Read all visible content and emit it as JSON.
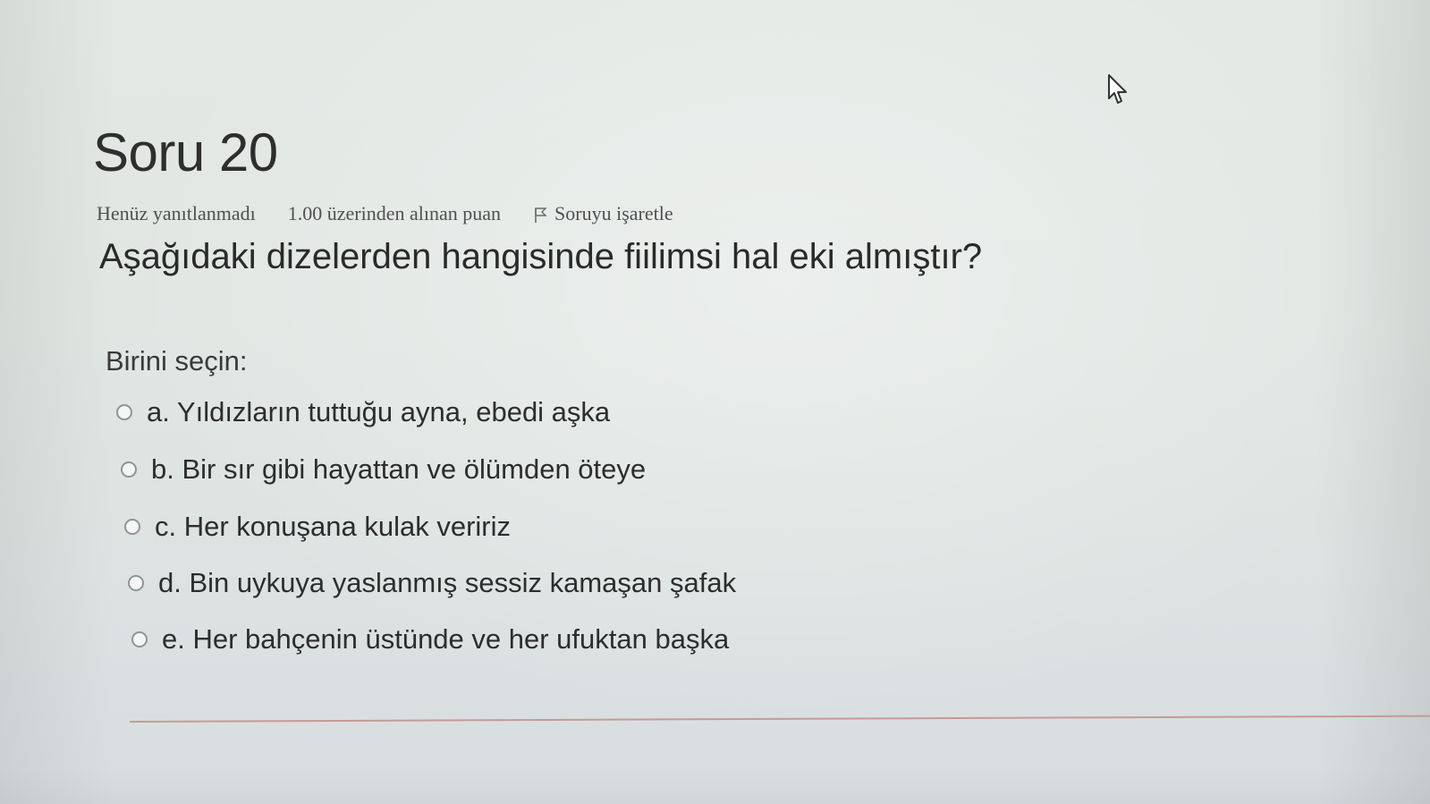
{
  "question": {
    "title": "Soru 20",
    "status": "Henüz yanıtlanmadı",
    "grade": "1.00 üzerinden alınan puan",
    "flag_label": "Soruyu işaretle",
    "text": "Aşağıdaki dizelerden hangisinde fiilimsi hal eki almıştır?"
  },
  "answers": {
    "prompt": "Birini seçin:",
    "options": [
      {
        "label": "a. Yıldızların tuttuğu ayna, ebedi aşka",
        "selected": false
      },
      {
        "label": "b. Bir sır gibi hayattan ve ölümden öteye",
        "selected": false
      },
      {
        "label": "c. Her konuşana kulak veririz",
        "selected": false
      },
      {
        "label": "d. Bin uykuya yaslanmış sessiz kamaşan şafak",
        "selected": false
      },
      {
        "label": "e. Her bahçenin üstünde ve her ufuktan başka",
        "selected": false
      }
    ]
  },
  "icons": {
    "flag": "flag-icon",
    "cursor": "mouse-pointer-icon",
    "radio": "radio-button-icon"
  }
}
